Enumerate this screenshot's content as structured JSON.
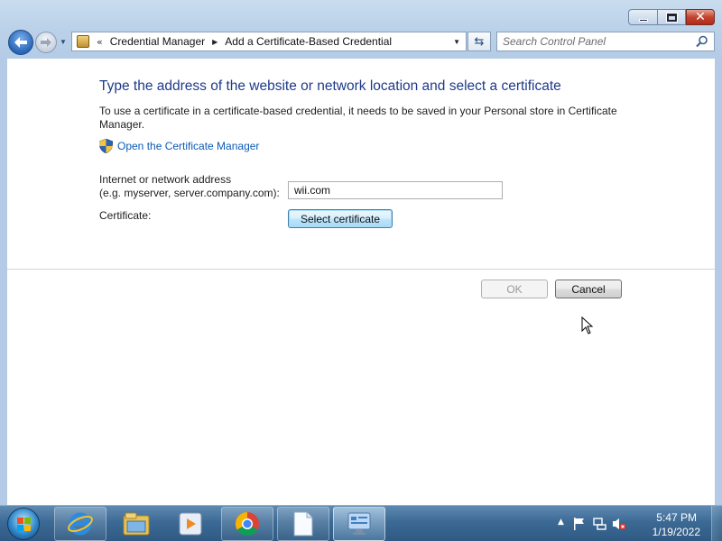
{
  "window": {
    "breadcrumb": {
      "overflow_chevron": "«",
      "items": [
        "Credential Manager",
        "Add a Certificate-Based Credential"
      ]
    },
    "search": {
      "placeholder": "Search Control Panel"
    },
    "caption_icons": [
      "minimize-icon",
      "maximize-icon",
      "close-icon"
    ]
  },
  "content": {
    "heading": "Type the address of the website or network location and select a certificate",
    "description": "To use a certificate in a certificate-based credential, it needs to be saved in your Personal store in Certificate Manager.",
    "cert_manager_link": "Open the Certificate Manager",
    "address_label_line1": "Internet or network address",
    "address_label_line2": "(e.g. myserver, server.company.com):",
    "address_value": "wii.com",
    "certificate_label": "Certificate:",
    "select_certificate_button": "Select certificate",
    "ok_button": "OK",
    "cancel_button": "Cancel"
  },
  "taskbar": {
    "pinned": [
      "internet-explorer-icon",
      "file-explorer-icon",
      "media-player-icon",
      "chrome-icon",
      "document-icon",
      "control-panel-icon"
    ],
    "tray_icons": [
      "show-hidden-icons-icon",
      "action-center-flag-icon",
      "network-icon",
      "volume-muted-icon"
    ],
    "time": "5:47 PM",
    "date": "1/19/2022"
  },
  "colors": {
    "heading": "#1e3a8a",
    "link": "#0e5ab5",
    "taskbar": "#3c6a95"
  }
}
